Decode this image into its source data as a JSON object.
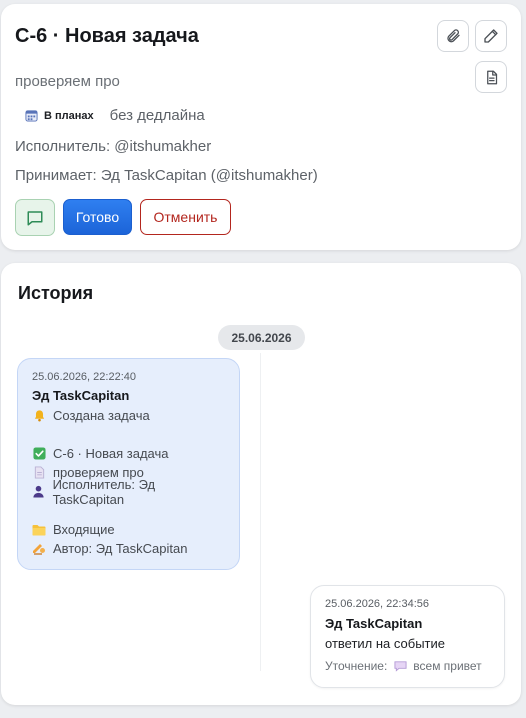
{
  "task": {
    "title": "C-6 · Новая задача",
    "description": "проверяем про",
    "status": "В планах",
    "deadline": "без дедлайна",
    "assignee": "Исполнитель: @itshumakher",
    "acceptor": "Принимает: Эд TaskCapitan (@itshumakher)",
    "done_label": "Готово",
    "cancel_label": "Отменить"
  },
  "history": {
    "title": "История",
    "date": "25.06.2026",
    "messages": [
      {
        "time": "25.06.2026, 22:22:40",
        "author": "Эд TaskCapitan",
        "lines": [
          "Создана задача",
          "C-6 · Новая задача",
          "проверяем про",
          "Исполнитель: Эд TaskCapitan",
          "Входящие",
          "Автор: Эд TaskCapitan"
        ]
      },
      {
        "time": "25.06.2026, 22:34:56",
        "author": "Эд TaskCapitan",
        "text": "ответил на событие",
        "clarification_label": "Уточнение:",
        "clarification_text": "всем привет"
      }
    ]
  },
  "colors": {
    "primary": "#1c64d8",
    "danger": "#b3261e",
    "chat_green": "#2e8b57",
    "bubble_bg": "#e6eefc"
  }
}
